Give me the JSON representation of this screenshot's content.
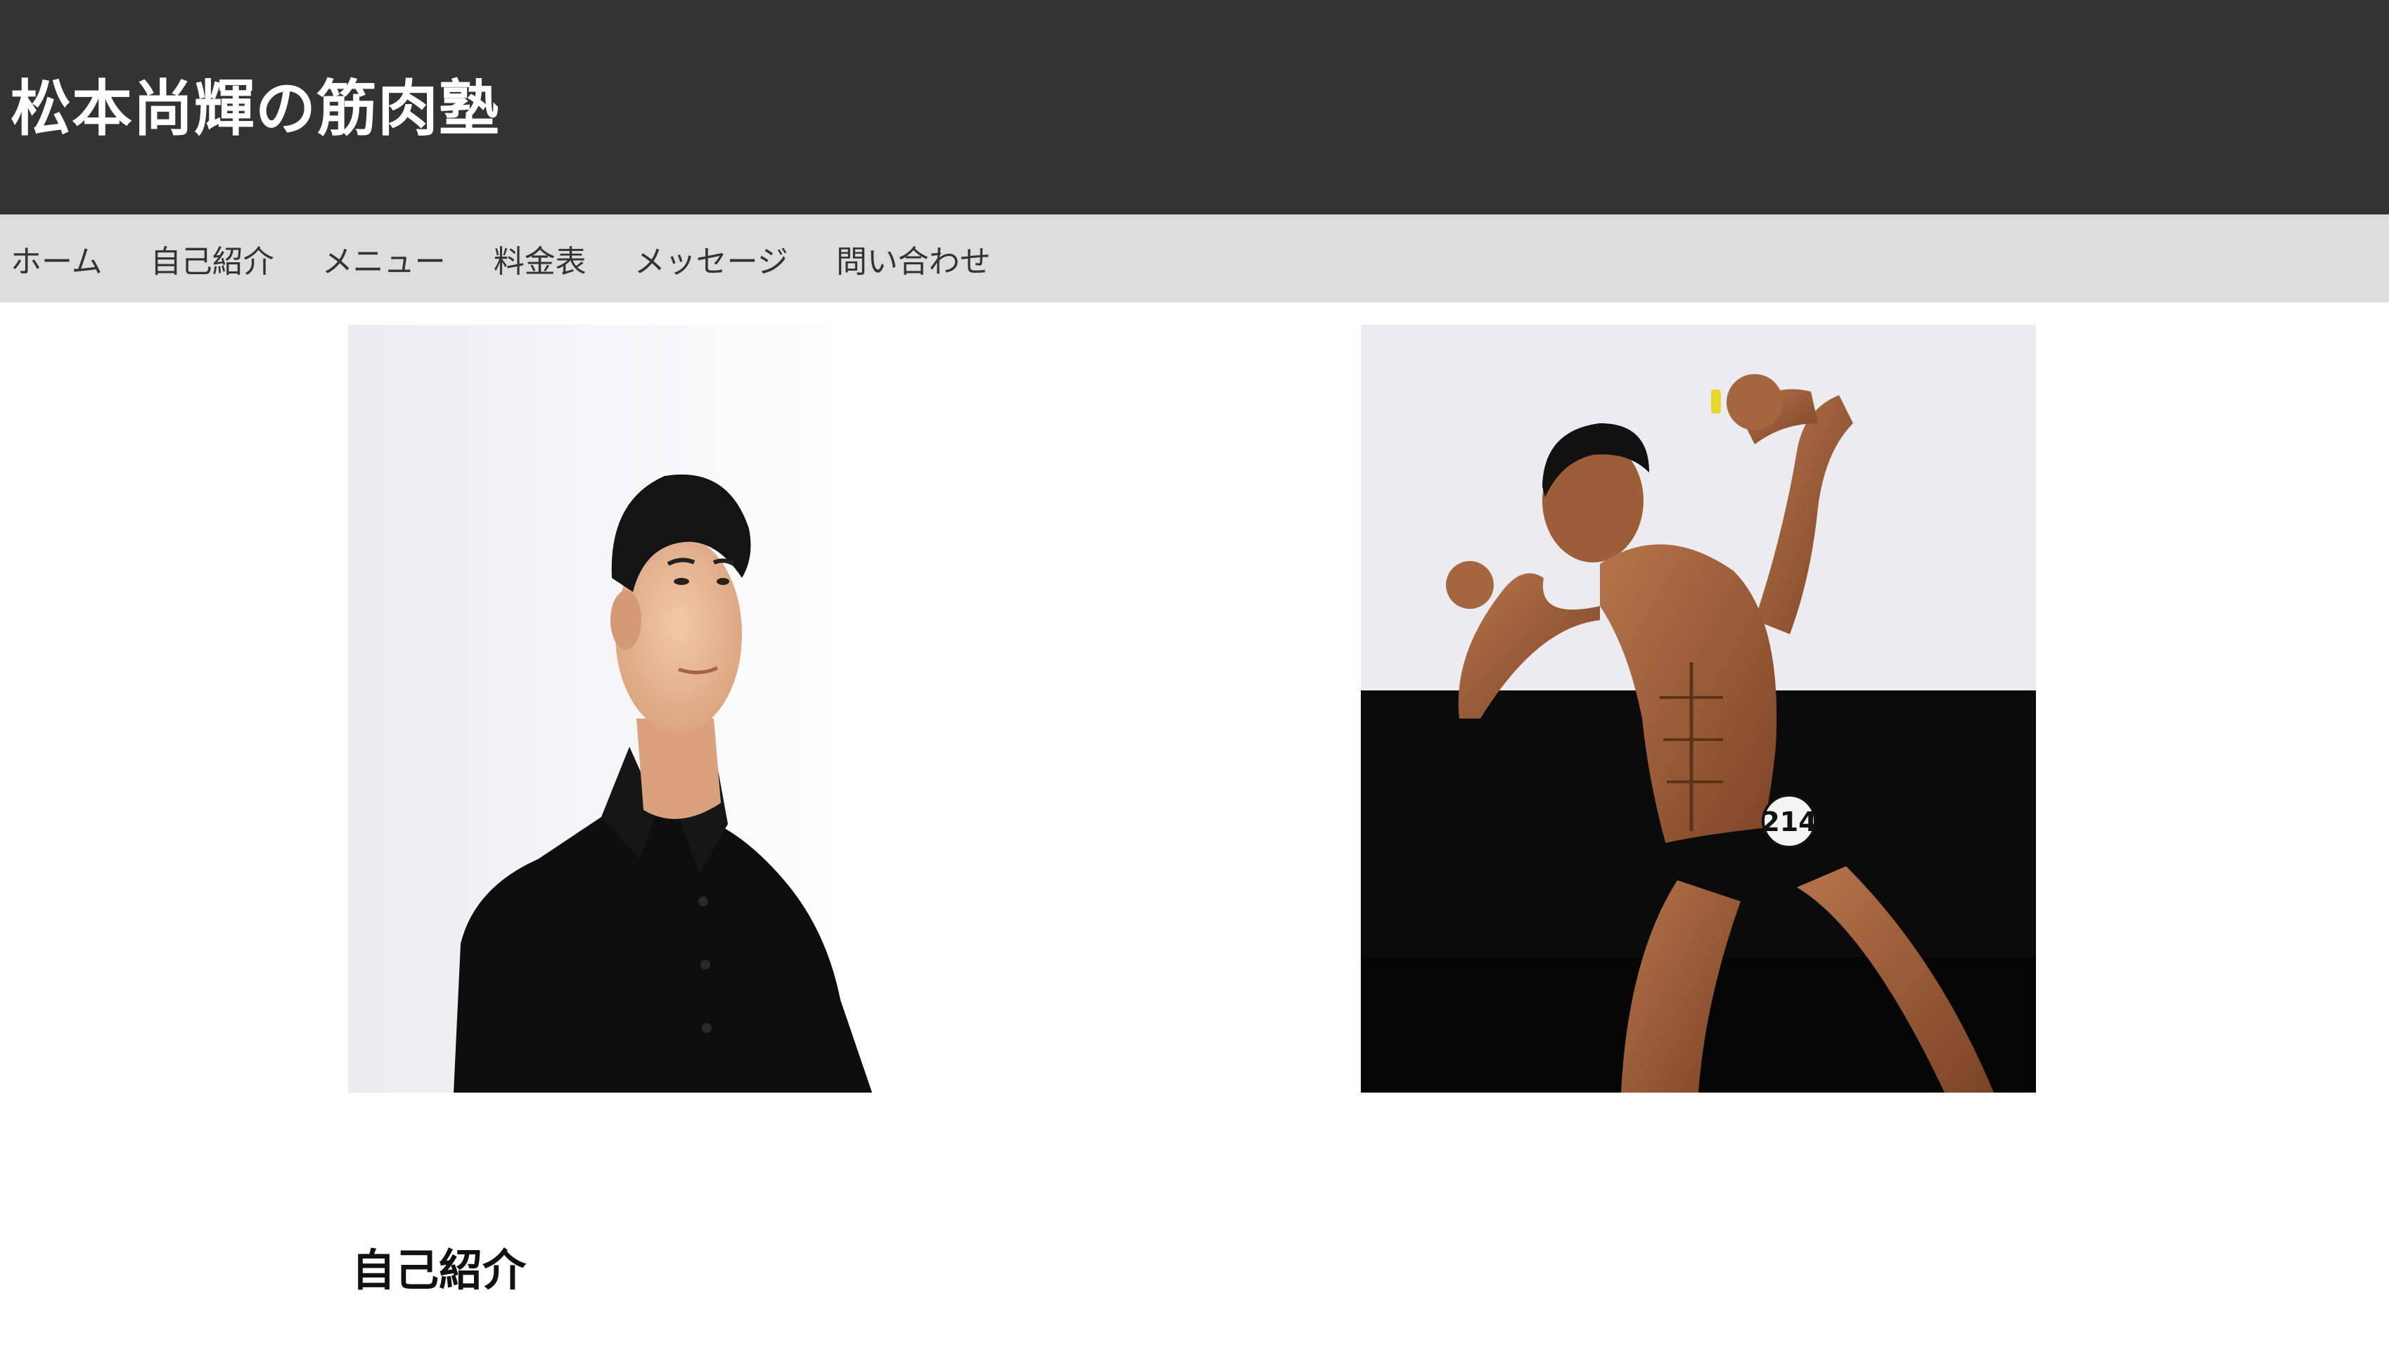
{
  "header": {
    "site_title": "松本尚輝の筋肉塾",
    "background_color": "#333333",
    "title_color": "#ffffff"
  },
  "nav": {
    "background_color": "#dddddd",
    "items": [
      {
        "label": "ホーム"
      },
      {
        "label": "自己紹介"
      },
      {
        "label": "メニュー"
      },
      {
        "label": "料金表"
      },
      {
        "label": "メッセージ"
      },
      {
        "label": "問い合わせ"
      }
    ]
  },
  "main": {
    "photos": [
      {
        "subject": "portrait-photo"
      },
      {
        "subject": "bodybuilder-photo",
        "bib_number": "214"
      }
    ],
    "section_heading": "自己紹介"
  }
}
